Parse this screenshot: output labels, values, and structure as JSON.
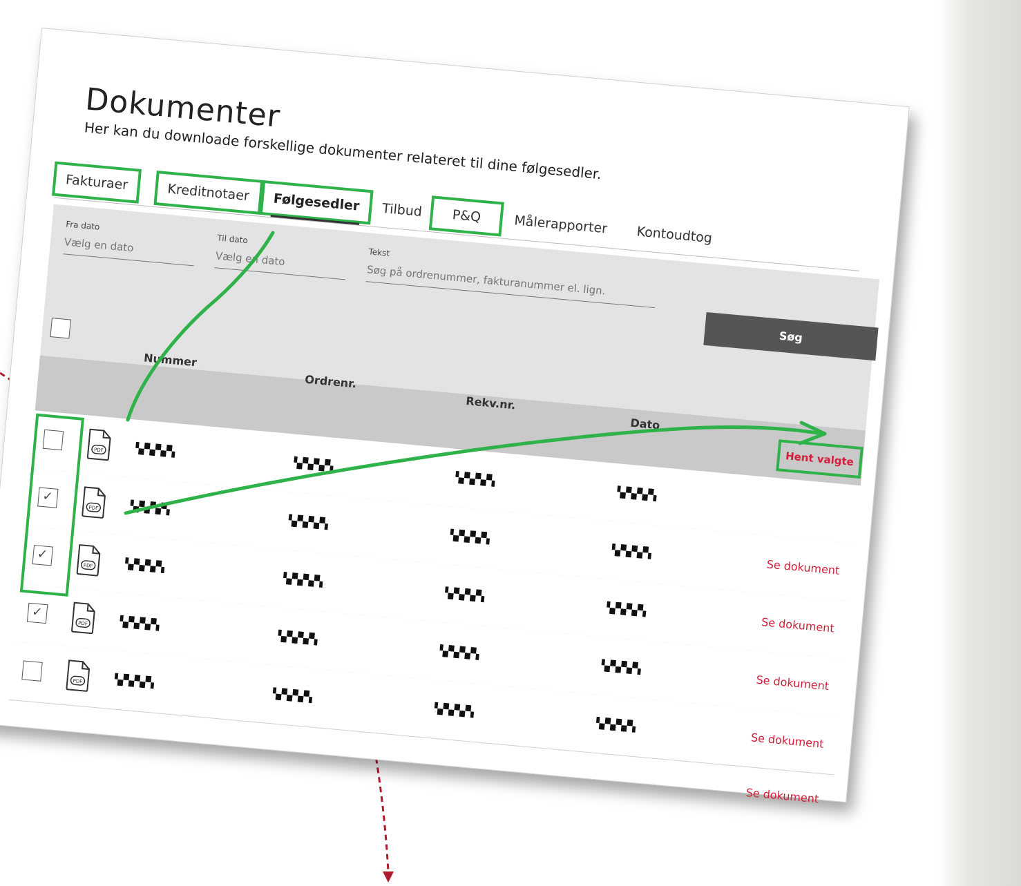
{
  "page": {
    "title": "Dokumenter",
    "subtitle": "Her kan du downloade forskellige dokumenter relateret til dine følgesedler."
  },
  "tabs": [
    {
      "label": "Fakturaer",
      "highlighted": true
    },
    {
      "label": "Kreditnotaer",
      "highlighted": true
    },
    {
      "label": "Følgesedler",
      "highlighted": true,
      "active": true
    },
    {
      "label": "Tilbud",
      "highlighted": false
    },
    {
      "label": "P&Q",
      "highlighted": true
    },
    {
      "label": "Målerapporter",
      "highlighted": false
    },
    {
      "label": "Kontoudtog",
      "highlighted": false
    }
  ],
  "filters": {
    "from_date": {
      "label": "Fra dato",
      "placeholder": "Vælg en dato"
    },
    "to_date": {
      "label": "Til dato",
      "placeholder": "Vælg en dato"
    },
    "text": {
      "label": "Tekst",
      "placeholder": "Søg på ordrenummer, fakturanummer el. lign."
    },
    "search_label": "Søg"
  },
  "table": {
    "headers": {
      "number": "Nummer",
      "order": "Ordrenr.",
      "requisition": "Rekv.nr.",
      "date": "Dato"
    },
    "bulk_action": "Hent valgte",
    "rows": [
      {
        "checked": false,
        "number": "▚▞▚▞▚▞▚",
        "order": "▚▞▚▞▚▞▚",
        "requisition": "▚▞▚▞▚▞▚",
        "date": "▚▞▚▞▚▞▚",
        "action": "Se dokument"
      },
      {
        "checked": true,
        "number": "▚▞▚▞▚▞▚",
        "order": "▚▞▚▞▚▞▚",
        "requisition": "▚▞▚▞▚▞▚",
        "date": "▚▞▚▞▚▞▚",
        "action": "Se dokument"
      },
      {
        "checked": true,
        "number": "▚▞▚▞▚▞▚",
        "order": "▚▞▚▞▚▞▚",
        "requisition": "▚▞▚▞▚▞▚",
        "date": "▚▞▚▞▚▞▚",
        "action": "Se dokument"
      },
      {
        "checked": true,
        "number": "▚▞▚▞▚▞▚",
        "order": "▚▞▚▞▚▞▚",
        "requisition": "▚▞▚▞▚▞▚",
        "date": "▚▞▚▞▚▞▚",
        "action": "Se dokument"
      },
      {
        "checked": false,
        "number": "▚▞▚▞▚▞▚",
        "order": "▚▞▚▞▚▞▚",
        "requisition": "▚▞▚▞▚▞▚",
        "date": "▚▞▚▞▚▞▚",
        "action": "Se dokument"
      }
    ]
  },
  "colors": {
    "accent": "#d3203a",
    "highlight": "#2fb24a",
    "button": "#555555"
  }
}
